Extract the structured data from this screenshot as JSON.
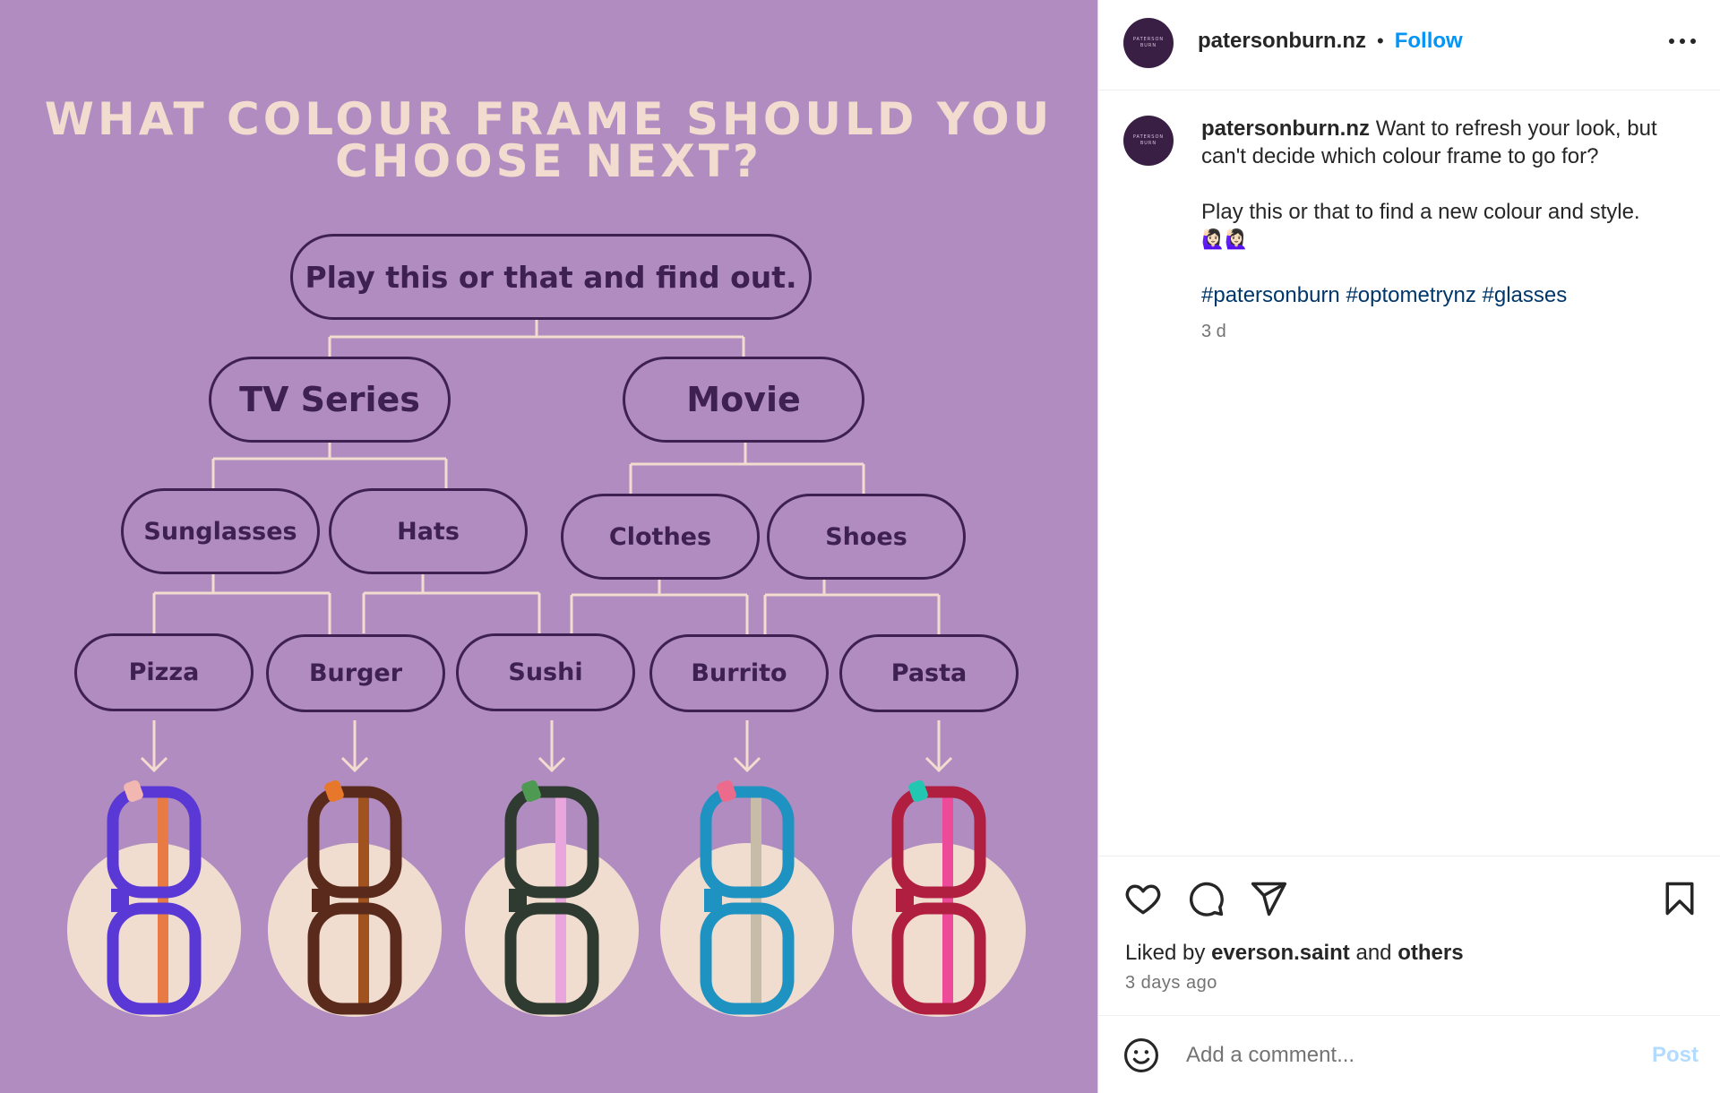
{
  "post": {
    "headline": [
      "WHAT COLOUR FRAME SHOULD YOU",
      "CHOOSE NEXT?"
    ],
    "root": "Play this or that and find out.",
    "level1": [
      "TV Series",
      "Movie"
    ],
    "level2": [
      "Sunglasses",
      "Hats",
      "Clothes",
      "Shoes"
    ],
    "level3": [
      "Pizza",
      "Burger",
      "Sushi",
      "Burrito",
      "Pasta"
    ],
    "glasses": [
      {
        "frame": "#5a38d6",
        "temple": "#e87b43",
        "accent": "#f1b7b0"
      },
      {
        "frame": "#5a2a1c",
        "temple": "#a0521f",
        "accent": "#e7772a"
      },
      {
        "frame": "#2f3a30",
        "temple": "#e9a6dc",
        "accent": "#4f9a52"
      },
      {
        "frame": "#1e93c2",
        "temple": "#c7bca8",
        "accent": "#ec6b8c"
      },
      {
        "frame": "#b01f3f",
        "temple": "#ed4a9a",
        "accent": "#23c6b0"
      }
    ]
  },
  "header": {
    "avatar_text": [
      "PATERSON",
      "BURN"
    ],
    "username": "patersonburn.nz",
    "separator": "•",
    "follow": "Follow"
  },
  "caption": {
    "username": "patersonburn.nz",
    "text_1": "Want to refresh your look, but can't decide which colour frame to go for?",
    "text_2": "Play this or that to find a new colour and style.",
    "emoji": "🙋🏻‍♀️🙋🏻‍♀️",
    "hashtags": [
      "#patersonburn",
      "#optometrynz",
      "#glasses"
    ],
    "age": "3 d"
  },
  "engagement": {
    "liked_prefix": "Liked by",
    "liked_user": "everson.saint",
    "liked_mid": "and",
    "liked_others": "others",
    "time": "3 days ago"
  },
  "comment": {
    "placeholder": "Add a comment...",
    "post": "Post"
  },
  "icons": {
    "more": "more-options-icon",
    "like": "heart-icon",
    "comment": "comment-icon",
    "share": "share-icon",
    "save": "bookmark-icon",
    "emoji": "emoji-icon"
  },
  "colors": {
    "post_bg": "#b18cc0",
    "pill_border": "#3e2150",
    "headline": "#f1dccf",
    "connector": "#f1dccf",
    "circle": "#f1ddd0",
    "link_blue": "#0095f6",
    "hashtag": "#00376b"
  }
}
